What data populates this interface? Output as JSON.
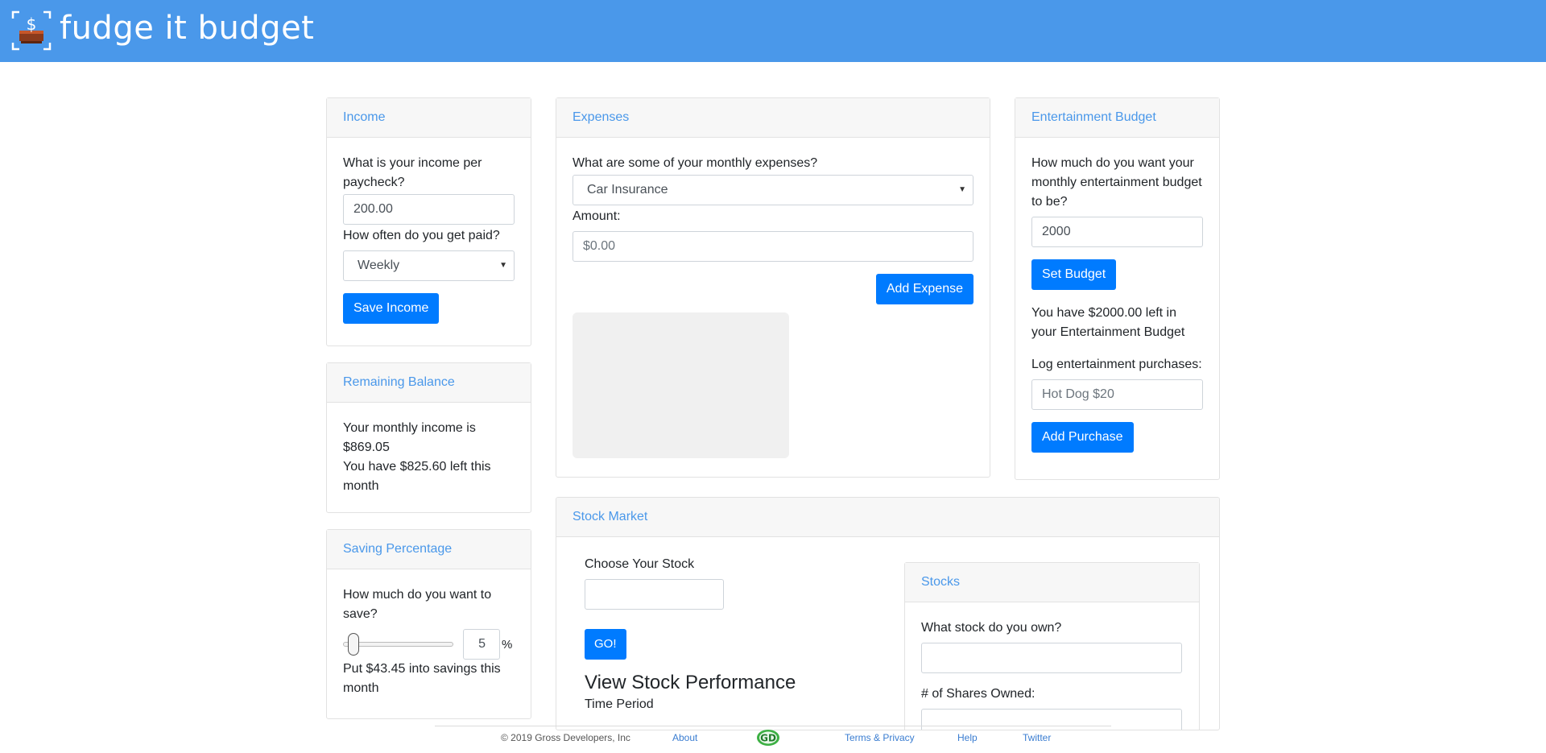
{
  "app": {
    "brand": "fudge it budget"
  },
  "income": {
    "title": "Income",
    "question": "What is your income per paycheck?",
    "value": "200.00",
    "frequency_question": "How often do you get paid?",
    "frequency_value": "Weekly",
    "save_label": "Save Income"
  },
  "balance": {
    "title": "Remaining Balance",
    "line1": "Your monthly income is $869.05",
    "line2": "You have $825.60 left this month"
  },
  "saving": {
    "title": "Saving Percentage",
    "question": "How much do you want to save?",
    "percent_value": "5",
    "percent_sign": "%",
    "slider_level_percent": 5,
    "result": "Put $43.45 into savings this month"
  },
  "expenses": {
    "title": "Expenses",
    "question": "What are some of your monthly expenses?",
    "category_value": "Car Insurance",
    "amount_label": "Amount:",
    "amount_placeholder": "$0.00",
    "add_label": "Add Expense"
  },
  "entertainment": {
    "title": "Entertainment Budget",
    "question": "How much do you want your monthly entertainment budget to be?",
    "budget_value": "2000",
    "set_label": "Set Budget",
    "remaining": "You have $2000.00 left in your Entertainment Budget",
    "log_label": "Log entertainment purchases:",
    "purchase_placeholder": "Hot Dog $20",
    "add_purchase_label": "Add Purchase"
  },
  "stock_market": {
    "title": "Stock Market",
    "choose_label": "Choose Your Stock",
    "go_label": "GO!",
    "performance_heading": "View Stock Performance",
    "time_period_label": "Time Period",
    "stocks": {
      "title": "Stocks",
      "own_question": "What stock do you own?",
      "shares_label": "# of Shares Owned:"
    }
  },
  "footer": {
    "copyright": "© 2019 Gross Developers, Inc",
    "about": "About",
    "logo_text": "GD",
    "terms": "Terms & Privacy",
    "help": "Help",
    "twitter": "Twitter"
  },
  "colors": {
    "navbar": "#4a98ea",
    "primary": "#007bff",
    "header_text": "#4a98ea"
  }
}
